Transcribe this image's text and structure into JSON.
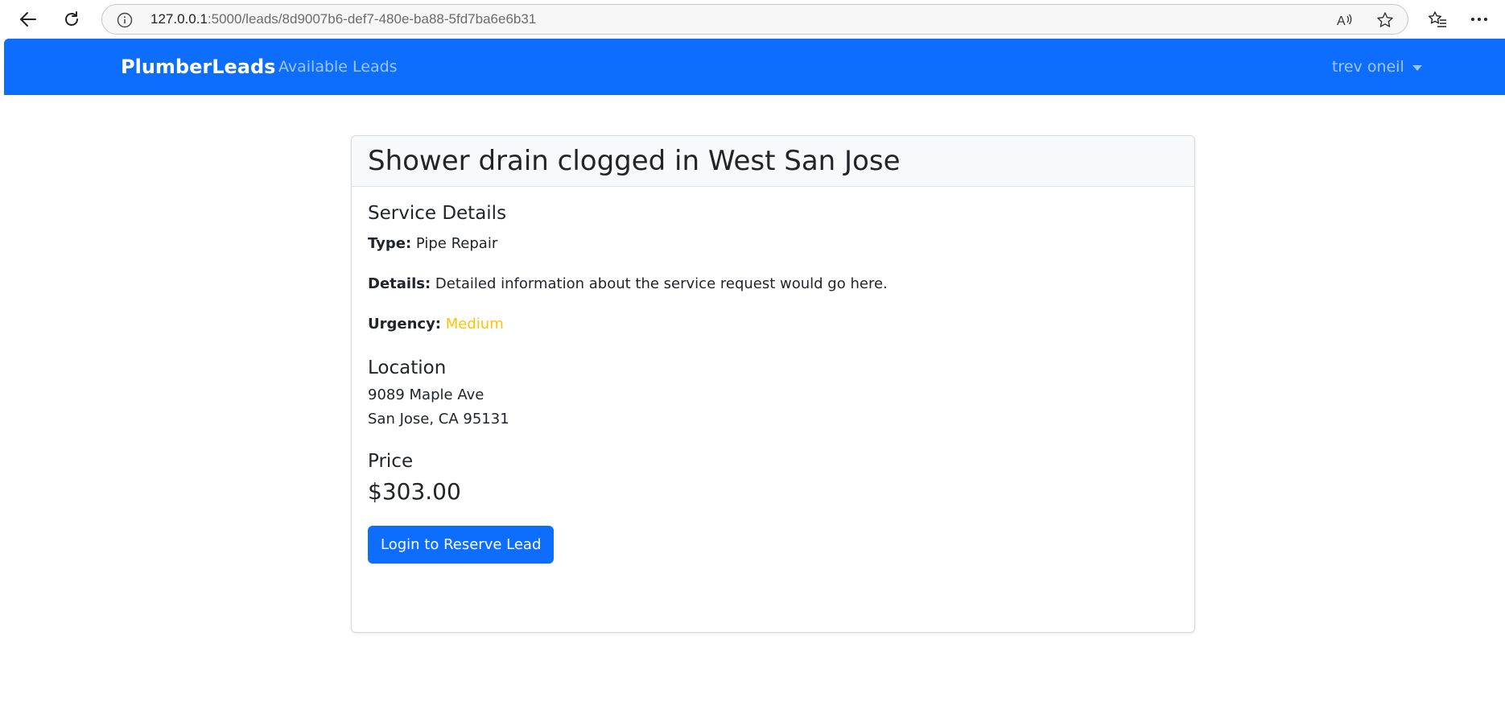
{
  "browser": {
    "url_host": "127.0.0.1",
    "url_path": ":5000/leads/8d9007b6-def7-480e-ba88-5fd7ba6e6b31",
    "icons": {
      "back": "back-arrow-icon",
      "refresh": "refresh-icon",
      "info": "info-icon",
      "read_aloud": "read-aloud-icon",
      "favorite": "star-icon",
      "favorites_list": "favorites-icon",
      "more": "more-icon"
    }
  },
  "navbar": {
    "brand": "PlumberLeads",
    "link_available": "Available Leads",
    "user_name": "trev oneil",
    "bg_color": "#0d6efd"
  },
  "lead": {
    "title": "Shower drain clogged in West San Jose",
    "service_heading": "Service Details",
    "type_label": "Type:",
    "type_value": "Pipe Repair",
    "details_label": "Details:",
    "details_value": "Detailed information about the service request would go here.",
    "urgency_label": "Urgency:",
    "urgency_value": "Medium",
    "urgency_color": "#ffc107",
    "location_heading": "Location",
    "address_line1": "9089 Maple Ave",
    "address_line2": "San Jose, CA 95131",
    "price_heading": "Price",
    "price_value": "$303.00",
    "reserve_button": "Login to Reserve Lead"
  }
}
